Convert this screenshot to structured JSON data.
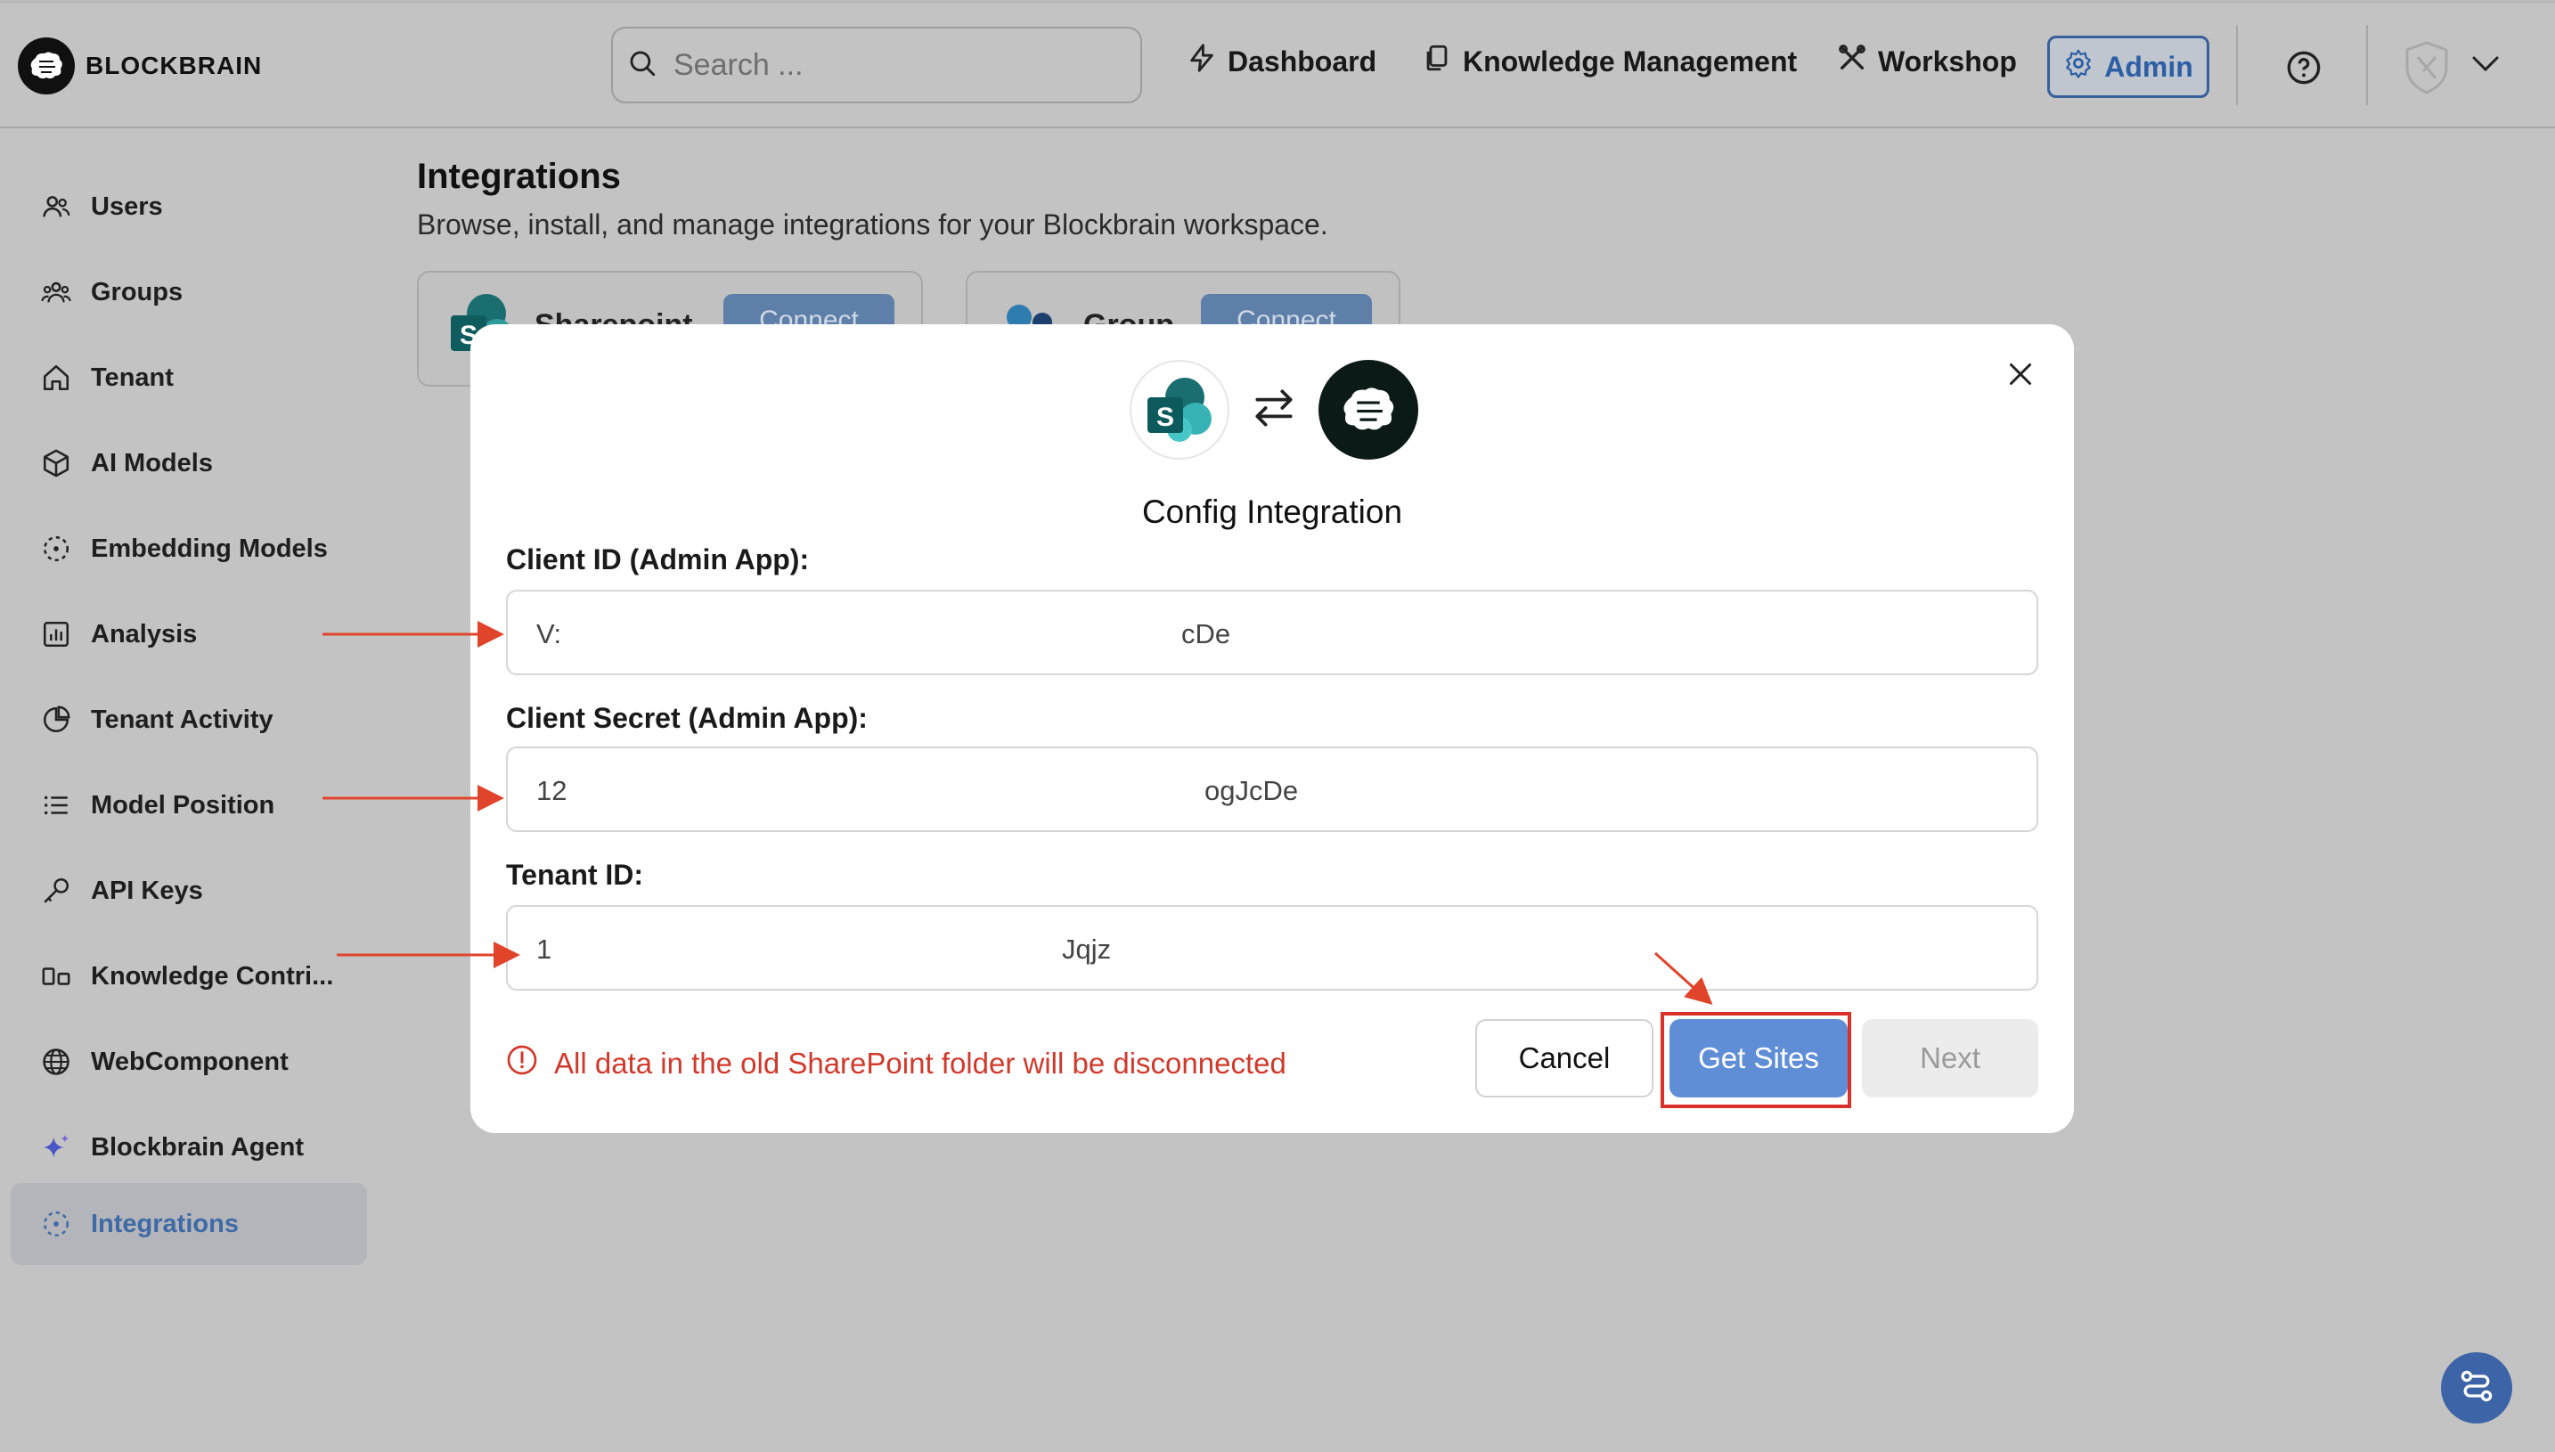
{
  "brand": {
    "name": "BLOCKBRAIN"
  },
  "search": {
    "placeholder": "Search ..."
  },
  "nav": {
    "dashboard": "Dashboard",
    "knowledge": "Knowledge Management",
    "workshop": "Workshop",
    "admin": "Admin"
  },
  "sidebar": {
    "items": [
      {
        "label": "Users",
        "icon": "users-icon"
      },
      {
        "label": "Groups",
        "icon": "groups-icon"
      },
      {
        "label": "Tenant",
        "icon": "home-icon"
      },
      {
        "label": "AI Models",
        "icon": "cube-icon"
      },
      {
        "label": "Embedding Models",
        "icon": "embedding-icon"
      },
      {
        "label": "Analysis",
        "icon": "bar-chart-icon"
      },
      {
        "label": "Tenant Activity",
        "icon": "pie-chart-icon"
      },
      {
        "label": "Model Position",
        "icon": "list-icon"
      },
      {
        "label": "API Keys",
        "icon": "key-icon"
      },
      {
        "label": "Knowledge Contri...",
        "icon": "contribution-icon"
      },
      {
        "label": "WebComponent",
        "icon": "globe-icon"
      },
      {
        "label": "Blockbrain Agent",
        "icon": "sparkle-icon"
      },
      {
        "label": "Integrations",
        "icon": "integrations-icon",
        "active": true
      }
    ]
  },
  "main": {
    "title": "Integrations",
    "subtitle": "Browse, install, and manage integrations for your Blockbrain workspace.",
    "cards": [
      {
        "name": "Sharepoint",
        "button": "Connect"
      },
      {
        "name": "Group",
        "button": "Connect"
      }
    ]
  },
  "modal": {
    "title": "Config Integration",
    "fields": {
      "client_id": {
        "label": "Client ID (Admin App):",
        "start": "V:",
        "end": "cDe"
      },
      "client_secret": {
        "label": "Client Secret (Admin App):",
        "start": "12",
        "end": "ogJcDe"
      },
      "tenant_id": {
        "label": "Tenant ID:",
        "start": "1",
        "end": "Jqjz"
      }
    },
    "warning": "All data in the old SharePoint folder will be disconnected",
    "buttons": {
      "cancel": "Cancel",
      "get_sites": "Get Sites",
      "next": "Next"
    }
  },
  "colors": {
    "accent": "#5f8ed6",
    "admin_blue": "#2d5fa5",
    "warning_red": "#d2392b",
    "annotation_red": "#e0452b"
  }
}
